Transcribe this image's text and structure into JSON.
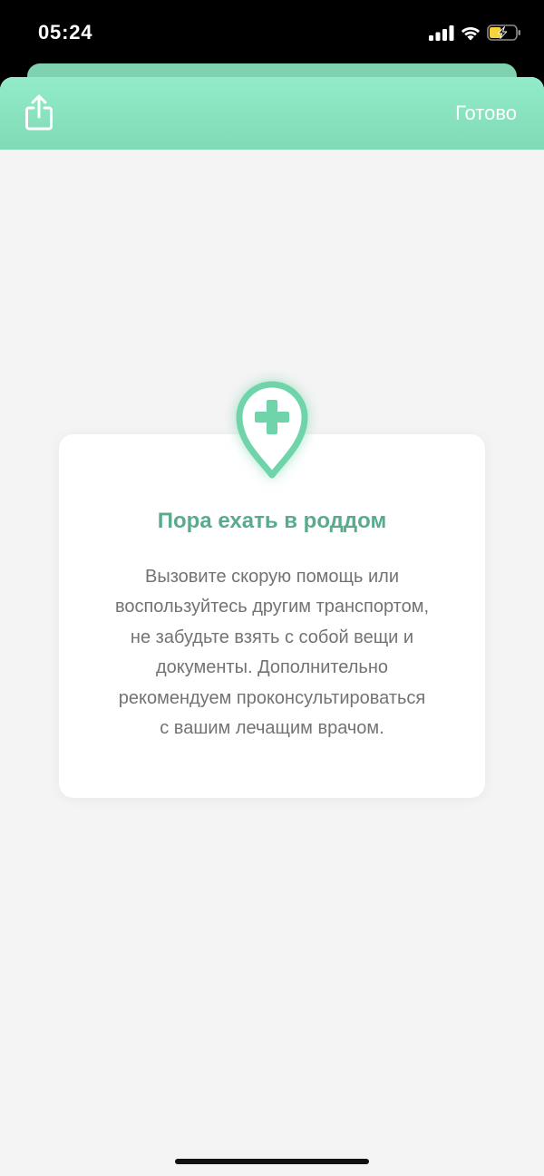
{
  "status_bar": {
    "time": "05:24",
    "signal_icon": "signal-icon",
    "wifi_icon": "wifi-icon",
    "battery_icon": "battery-charging-icon",
    "battery_level": 0.45,
    "battery_charging": true
  },
  "sheet_header": {
    "share_icon": "share-icon",
    "done_label": "Готово"
  },
  "alert_card": {
    "icon": "hospital-location-pin-icon",
    "title": "Пора ехать в роддом",
    "body_lines": [
      "Вызовите скорую помощь или",
      "воспользуйтесь другим транспортом,",
      "не забудьте взять с собой вещи и",
      "документы. Дополнительно",
      "рекомендуем проконсультироваться",
      "с вашим лечащим врачом."
    ]
  },
  "colors": {
    "header_gradient_top": "#93ecc9",
    "header_gradient_bottom": "#7fdab5",
    "accent": "#6fd4a9",
    "title": "#5aab8b",
    "body_text": "#737373",
    "background": "#f4f4f4",
    "card": "#ffffff",
    "battery_fill": "#f5d33d"
  }
}
